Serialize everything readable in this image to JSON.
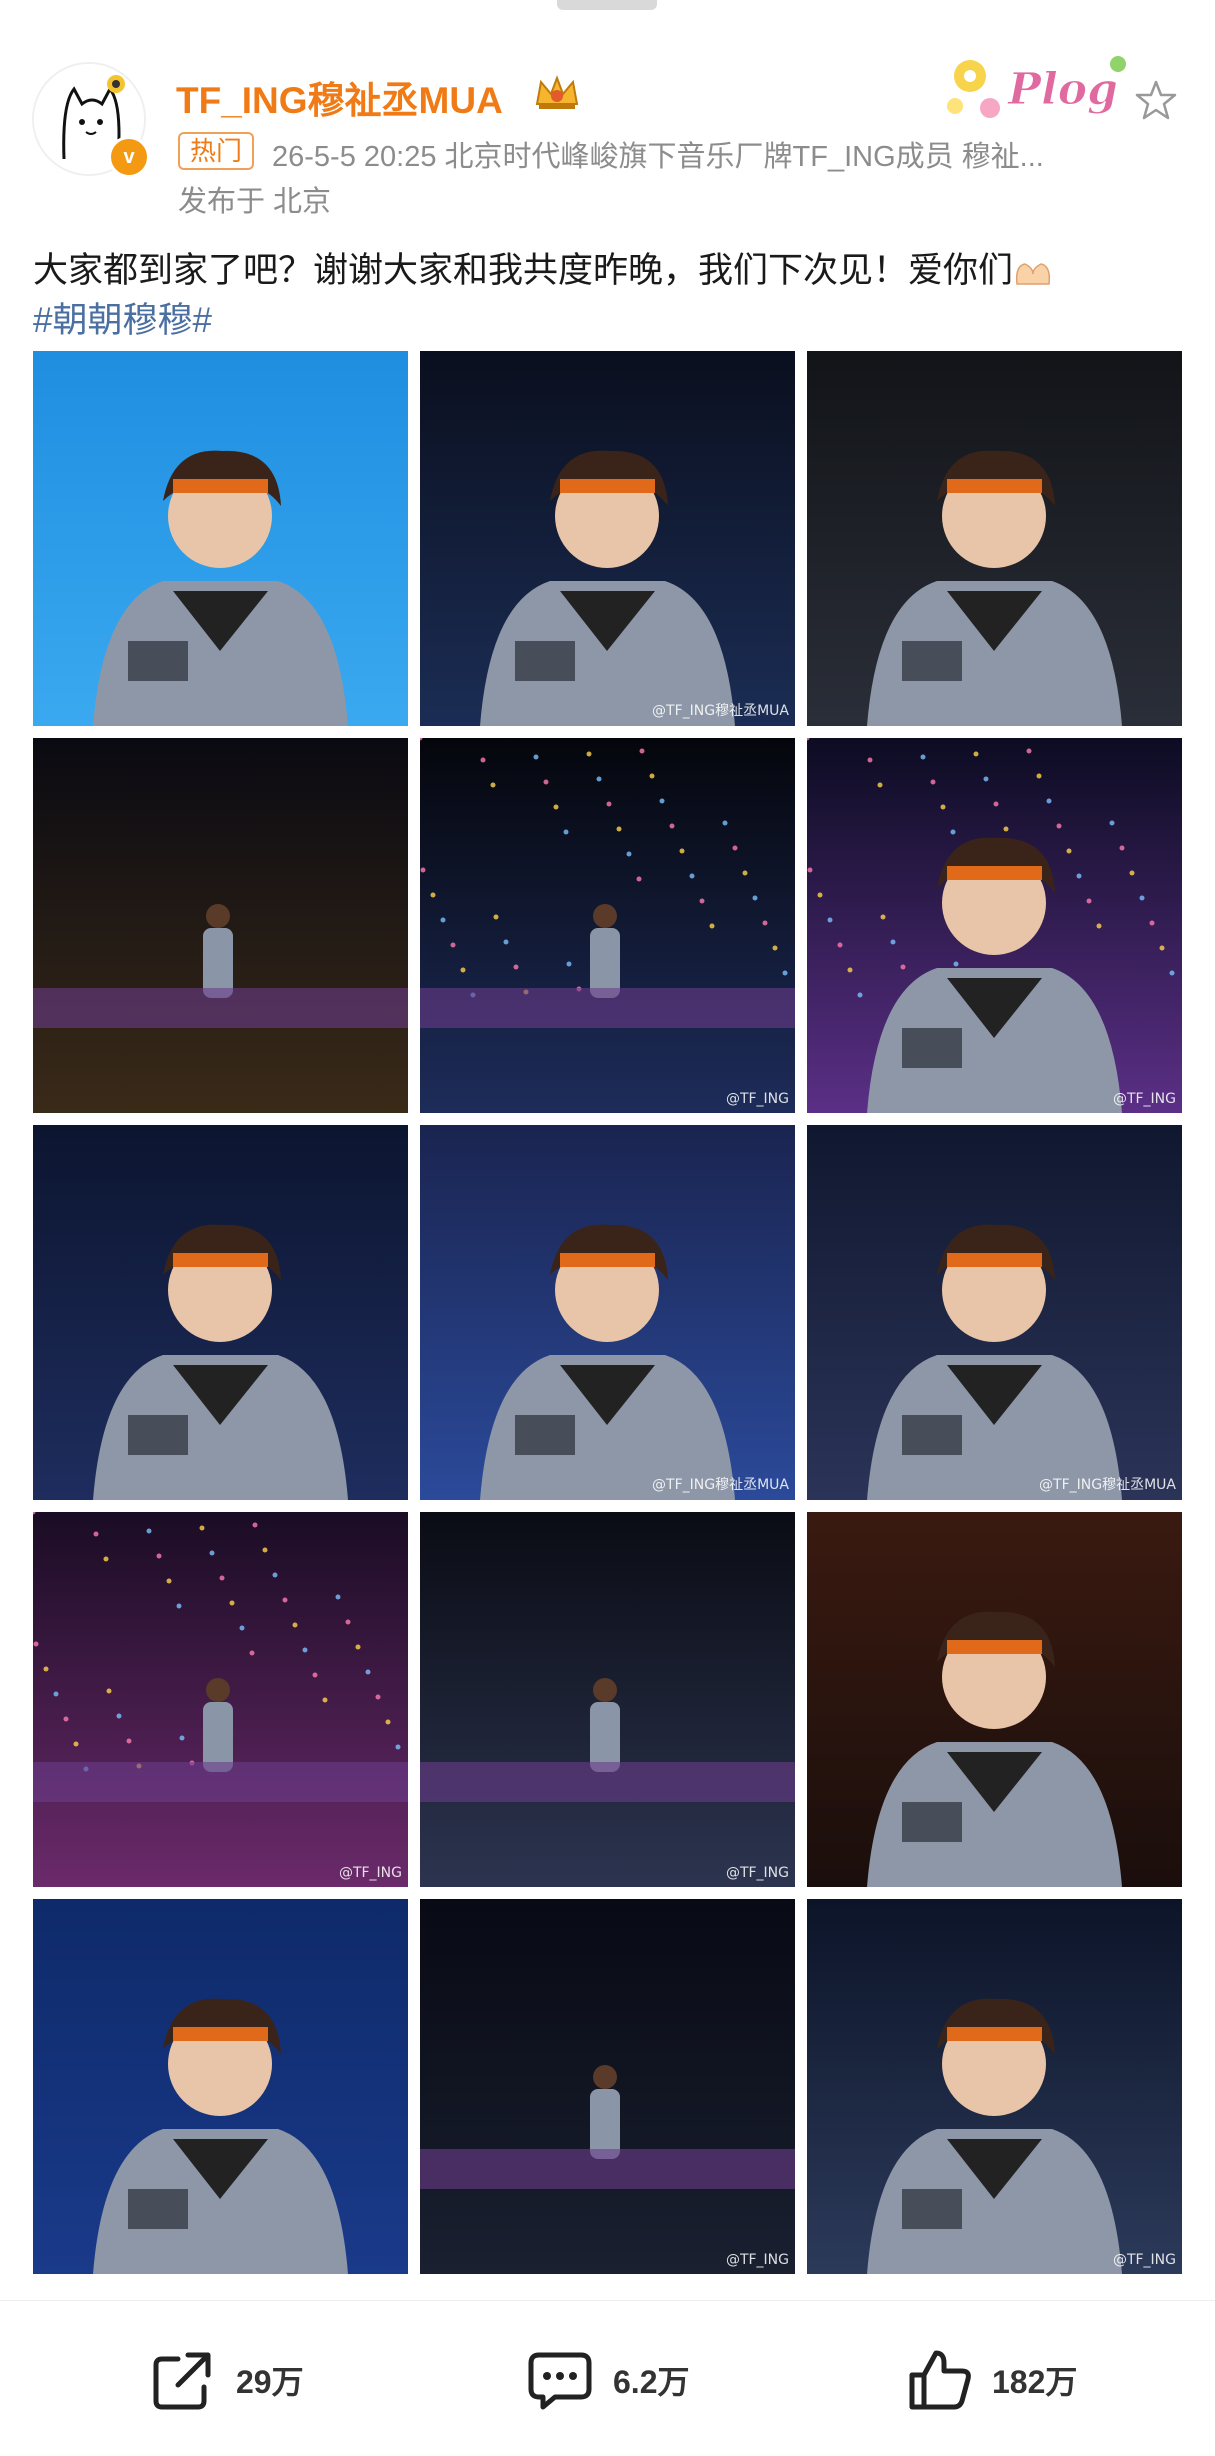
{
  "header": {
    "username": "TF_ING穆祉丞MUA",
    "hot_tag": "热门",
    "meta": "26-5-5 20:25  北京时代峰峻旗下音乐厂牌TF_ING成员 穆祉...",
    "location": "发布于 北京",
    "badge": "Plog"
  },
  "post": {
    "text": "大家都到家了吧？谢谢大家和我共度昨晚，我们下次见！爱你们",
    "hashtag": "#朝朝穆穆#"
  },
  "photos": [
    {
      "label": "photo-1",
      "watermark": ""
    },
    {
      "label": "photo-2",
      "watermark": "@TF_ING穆祉丞MUA"
    },
    {
      "label": "photo-3",
      "watermark": ""
    },
    {
      "label": "photo-4",
      "watermark": ""
    },
    {
      "label": "photo-5",
      "watermark": "@TF_ING"
    },
    {
      "label": "photo-6",
      "watermark": "@TF_ING"
    },
    {
      "label": "photo-7",
      "watermark": ""
    },
    {
      "label": "photo-8",
      "watermark": "@TF_ING穆祉丞MUA"
    },
    {
      "label": "photo-9",
      "watermark": "@TF_ING穆祉丞MUA"
    },
    {
      "label": "photo-10",
      "watermark": "@TF_ING"
    },
    {
      "label": "photo-11",
      "watermark": "@TF_ING"
    },
    {
      "label": "photo-12",
      "watermark": ""
    },
    {
      "label": "photo-13",
      "watermark": ""
    },
    {
      "label": "photo-14",
      "watermark": "@TF_ING"
    },
    {
      "label": "photo-15",
      "watermark": "@TF_ING"
    }
  ],
  "actions": {
    "repost": "29万",
    "comment": "6.2万",
    "like": "182万"
  },
  "colors": {
    "username": "#f07b16",
    "hashtag": "#4a6fa0",
    "meta": "#8c8c8c",
    "verified": "#f49a12"
  },
  "icons": {
    "repost": "share-arrow-icon",
    "comment": "comment-bubble-icon",
    "like": "thumbs-up-icon",
    "favorite": "star-icon",
    "crown": "crown-icon"
  }
}
